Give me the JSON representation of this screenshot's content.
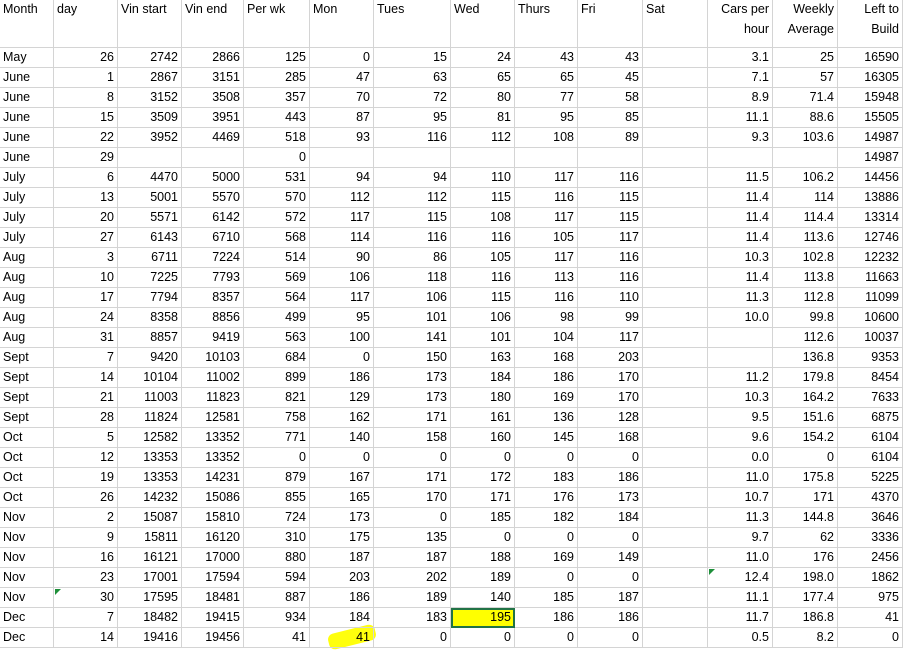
{
  "columns": [
    {
      "key": "month",
      "label": "Month",
      "align": "txt"
    },
    {
      "key": "day",
      "label": "day",
      "align": "num"
    },
    {
      "key": "vin_start",
      "label": "Vin start",
      "align": "num"
    },
    {
      "key": "vin_end",
      "label": "Vin end",
      "align": "num"
    },
    {
      "key": "per_wk",
      "label": "Per wk",
      "align": "num"
    },
    {
      "key": "mon",
      "label": "Mon",
      "align": "num"
    },
    {
      "key": "tues",
      "label": "Tues",
      "align": "num"
    },
    {
      "key": "wed",
      "label": "Wed",
      "align": "num"
    },
    {
      "key": "thurs",
      "label": "Thurs",
      "align": "num"
    },
    {
      "key": "fri",
      "label": "Fri",
      "align": "num"
    },
    {
      "key": "sat",
      "label": "Sat",
      "align": "num"
    },
    {
      "key": "cars_per_hour",
      "label": "Cars per hour",
      "align": "num"
    },
    {
      "key": "weekly_average",
      "label": "Weekly Average",
      "align": "num"
    },
    {
      "key": "left_to_build",
      "label": "Left to Build",
      "align": "num"
    }
  ],
  "rows": [
    [
      "May",
      "26",
      "2742",
      "2866",
      "125",
      "0",
      "15",
      "24",
      "43",
      "43",
      "",
      "3.1",
      "25",
      "16590"
    ],
    [
      "June",
      "1",
      "2867",
      "3151",
      "285",
      "47",
      "63",
      "65",
      "65",
      "45",
      "",
      "7.1",
      "57",
      "16305"
    ],
    [
      "June",
      "8",
      "3152",
      "3508",
      "357",
      "70",
      "72",
      "80",
      "77",
      "58",
      "",
      "8.9",
      "71.4",
      "15948"
    ],
    [
      "June",
      "15",
      "3509",
      "3951",
      "443",
      "87",
      "95",
      "81",
      "95",
      "85",
      "",
      "11.1",
      "88.6",
      "15505"
    ],
    [
      "June",
      "22",
      "3952",
      "4469",
      "518",
      "93",
      "116",
      "112",
      "108",
      "89",
      "",
      "9.3",
      "103.6",
      "14987"
    ],
    [
      "June",
      "29",
      "",
      "",
      "0",
      "",
      "",
      "",
      "",
      "",
      "",
      "",
      "",
      "14987"
    ],
    [
      "July",
      "6",
      "4470",
      "5000",
      "531",
      "94",
      "94",
      "110",
      "117",
      "116",
      "",
      "11.5",
      "106.2",
      "14456"
    ],
    [
      "July",
      "13",
      "5001",
      "5570",
      "570",
      "112",
      "112",
      "115",
      "116",
      "115",
      "",
      "11.4",
      "114",
      "13886"
    ],
    [
      "July",
      "20",
      "5571",
      "6142",
      "572",
      "117",
      "115",
      "108",
      "117",
      "115",
      "",
      "11.4",
      "114.4",
      "13314"
    ],
    [
      "July",
      "27",
      "6143",
      "6710",
      "568",
      "114",
      "116",
      "116",
      "105",
      "117",
      "",
      "11.4",
      "113.6",
      "12746"
    ],
    [
      "Aug",
      "3",
      "6711",
      "7224",
      "514",
      "90",
      "86",
      "105",
      "117",
      "116",
      "",
      "10.3",
      "102.8",
      "12232"
    ],
    [
      "Aug",
      "10",
      "7225",
      "7793",
      "569",
      "106",
      "118",
      "116",
      "113",
      "116",
      "",
      "11.4",
      "113.8",
      "11663"
    ],
    [
      "Aug",
      "17",
      "7794",
      "8357",
      "564",
      "117",
      "106",
      "115",
      "116",
      "110",
      "",
      "11.3",
      "112.8",
      "11099"
    ],
    [
      "Aug",
      "24",
      "8358",
      "8856",
      "499",
      "95",
      "101",
      "106",
      "98",
      "99",
      "",
      "10.0",
      "99.8",
      "10600"
    ],
    [
      "Aug",
      "31",
      "8857",
      "9419",
      "563",
      "100",
      "141",
      "101",
      "104",
      "117",
      "",
      "",
      "112.6",
      "10037"
    ],
    [
      "Sept",
      "7",
      "9420",
      "10103",
      "684",
      "0",
      "150",
      "163",
      "168",
      "203",
      "",
      "",
      "136.8",
      "9353"
    ],
    [
      "Sept",
      "14",
      "10104",
      "11002",
      "899",
      "186",
      "173",
      "184",
      "186",
      "170",
      "",
      "11.2",
      "179.8",
      "8454"
    ],
    [
      "Sept",
      "21",
      "11003",
      "11823",
      "821",
      "129",
      "173",
      "180",
      "169",
      "170",
      "",
      "10.3",
      "164.2",
      "7633"
    ],
    [
      "Sept",
      "28",
      "11824",
      "12581",
      "758",
      "162",
      "171",
      "161",
      "136",
      "128",
      "",
      "9.5",
      "151.6",
      "6875"
    ],
    [
      "Oct",
      "5",
      "12582",
      "13352",
      "771",
      "140",
      "158",
      "160",
      "145",
      "168",
      "",
      "9.6",
      "154.2",
      "6104"
    ],
    [
      "Oct",
      "12",
      "13353",
      "13352",
      "0",
      "0",
      "0",
      "0",
      "0",
      "0",
      "",
      "0.0",
      "0",
      "6104"
    ],
    [
      "Oct",
      "19",
      "13353",
      "14231",
      "879",
      "167",
      "171",
      "172",
      "183",
      "186",
      "",
      "11.0",
      "175.8",
      "5225"
    ],
    [
      "Oct",
      "26",
      "14232",
      "15086",
      "855",
      "165",
      "170",
      "171",
      "176",
      "173",
      "",
      "10.7",
      "171",
      "4370"
    ],
    [
      "Nov",
      "2",
      "15087",
      "15810",
      "724",
      "173",
      "0",
      "185",
      "182",
      "184",
      "",
      "11.3",
      "144.8",
      "3646"
    ],
    [
      "Nov",
      "9",
      "15811",
      "16120",
      "310",
      "175",
      "135",
      "0",
      "0",
      "0",
      "",
      "9.7",
      "62",
      "3336"
    ],
    [
      "Nov",
      "16",
      "16121",
      "17000",
      "880",
      "187",
      "187",
      "188",
      "169",
      "149",
      "",
      "11.0",
      "176",
      "2456"
    ],
    [
      "Nov",
      "23",
      "17001",
      "17594",
      "594",
      "203",
      "202",
      "189",
      "0",
      "0",
      "",
      "12.4",
      "198.0",
      "1862"
    ],
    [
      "Nov",
      "30",
      "17595",
      "18481",
      "887",
      "186",
      "189",
      "140",
      "185",
      "187",
      "",
      "11.1",
      "177.4",
      "975"
    ],
    [
      "Dec",
      "7",
      "18482",
      "19415",
      "934",
      "184",
      "183",
      "195",
      "186",
      "186",
      "",
      "11.7",
      "186.8",
      "41"
    ],
    [
      "Dec",
      "14",
      "19416",
      "19456",
      "41",
      "41",
      "0",
      "0",
      "0",
      "0",
      "",
      "0.5",
      "8.2",
      "0"
    ]
  ],
  "selected_cell": {
    "row": 28,
    "col": "wed"
  },
  "highlighted_cells": [
    {
      "row": 28,
      "col": "wed"
    },
    {
      "row": 29,
      "col": "mon"
    }
  ],
  "highlight_color": "#ffff00",
  "grid_color": "#d4d4d4",
  "selection_color": "#217346"
}
